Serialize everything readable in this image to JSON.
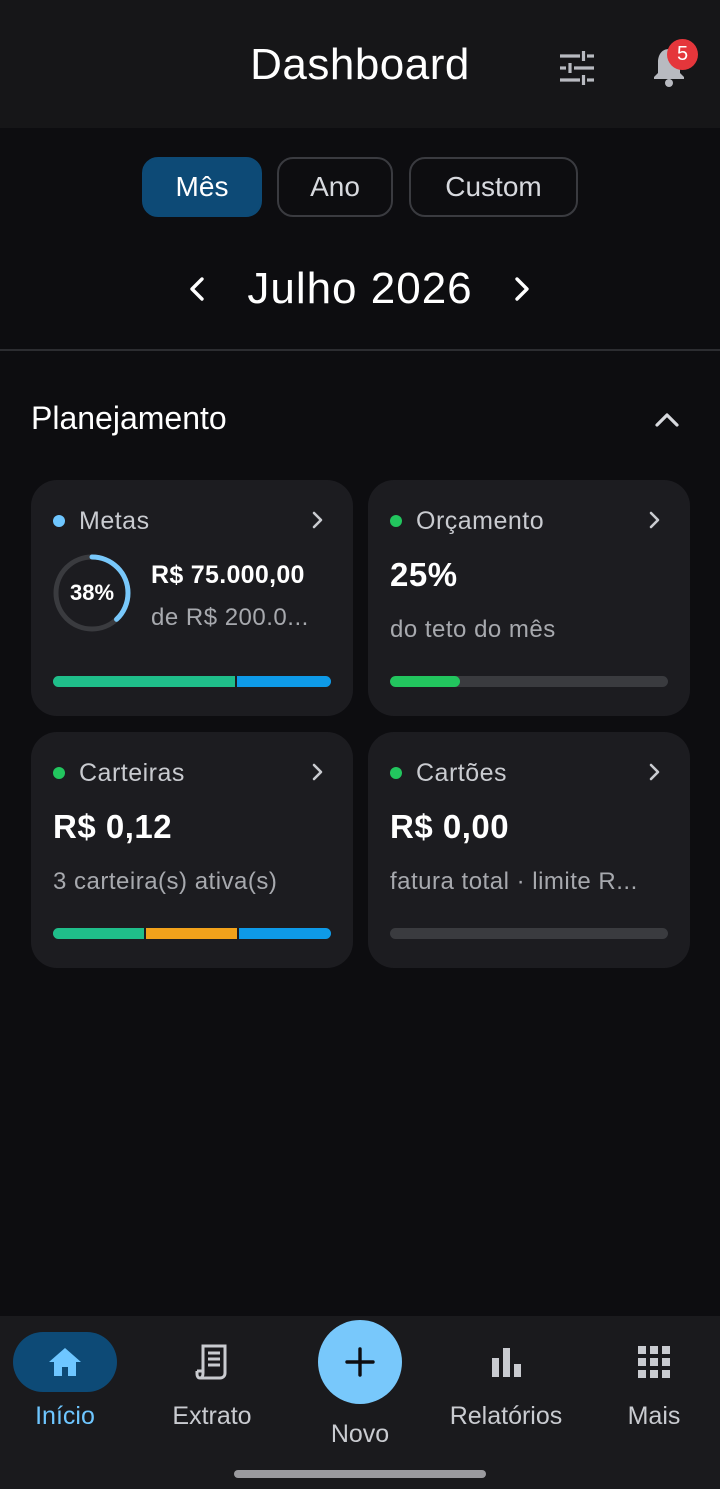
{
  "header": {
    "title": "Dashboard",
    "filter_icon": "sliders-icon",
    "bell_icon": "bell-icon",
    "notification_count": "5"
  },
  "period_tabs": [
    {
      "label": "Mês",
      "active": true
    },
    {
      "label": "Ano",
      "active": false
    },
    {
      "label": "Custom",
      "active": false
    }
  ],
  "month_selector": {
    "label": "Julho 2026"
  },
  "section": {
    "title": "Planejamento",
    "collapsed": false
  },
  "cards": {
    "metas": {
      "label": "Metas",
      "dot_color": "#6ec6ff",
      "progress_percent": "38%",
      "progress_fraction": 0.38,
      "value": "R$ 75.000,00",
      "sub": "de R$ 200.0...",
      "bar_segments": [
        {
          "color": "#1fbe8a",
          "fraction": 0.66
        },
        {
          "color": "#0e9ae8",
          "fraction": 0.34
        }
      ]
    },
    "orcamento": {
      "label": "Orçamento",
      "dot_color": "#22c55e",
      "value": "25%",
      "sub": "do teto do mês",
      "bar_fill": {
        "color": "#22c55e",
        "fraction": 0.25
      }
    },
    "carteiras": {
      "label": "Carteiras",
      "dot_color": "#22c55e",
      "value": "R$ 0,12",
      "sub": "3 carteira(s) ativa(s)",
      "bar_segments": [
        {
          "color": "#1fbe8a",
          "fraction": 0.333
        },
        {
          "color": "#f2a21b",
          "fraction": 0.333
        },
        {
          "color": "#0e9ae8",
          "fraction": 0.334
        }
      ]
    },
    "cartoes": {
      "label": "Cartões",
      "dot_color": "#22c55e",
      "value": "R$ 0,00",
      "sub": "fatura total · limite R...",
      "bar_fill": {
        "color": "#3a3b3f",
        "fraction": 0
      }
    }
  },
  "bottom_nav": {
    "items": [
      {
        "label": "Início",
        "icon": "home-icon",
        "active": true
      },
      {
        "label": "Extrato",
        "icon": "receipt-icon",
        "active": false
      },
      {
        "label": "Relatórios",
        "icon": "bar-chart-icon",
        "active": false
      },
      {
        "label": "Mais",
        "icon": "grid-icon",
        "active": false
      }
    ],
    "fab_label": "Novo",
    "fab_icon": "plus-icon"
  },
  "colors": {
    "accent": "#78c8fb",
    "active_tab": "#0d4a76",
    "badge": "#e5363b"
  }
}
